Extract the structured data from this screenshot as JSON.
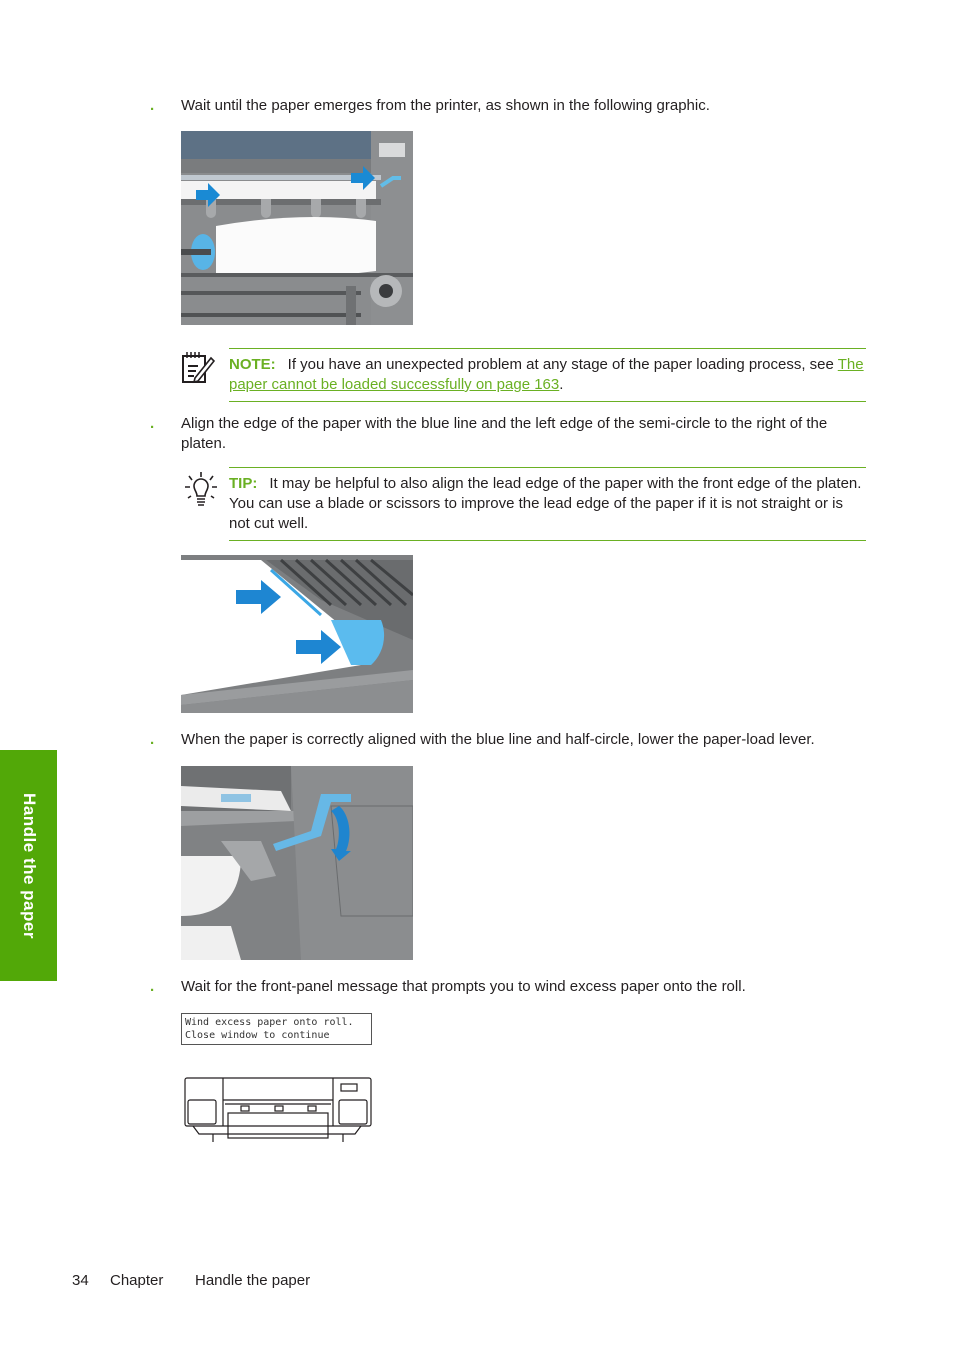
{
  "steps": [
    {
      "bullet": ".",
      "text": "Wait until the paper emerges from the printer, as shown in the following graphic."
    },
    {
      "bullet": ".",
      "text": "Align the edge of the paper with the blue line and the left edge of the semi-circle to the right of the platen."
    },
    {
      "bullet": ".",
      "text": "When the paper is correctly aligned with the blue line and half-circle, lower the paper-load lever."
    },
    {
      "bullet": ".",
      "text": "Wait for the front-panel message that prompts you to wind excess paper onto the roll."
    }
  ],
  "note": {
    "icon": "note-pencil-icon",
    "label": "NOTE:",
    "text_before": "If you have an unexpected problem at any stage of the paper loading process, see ",
    "link_text": "The paper cannot be loaded successfully on page 163",
    "text_after": "."
  },
  "tip": {
    "icon": "lightbulb-icon",
    "label": "TIP:",
    "text": "It may be helpful to also align the lead edge of the paper with the front edge of the platen. You can use a blade or scissors to improve the lead edge of the paper if it is not straight or is not cut well."
  },
  "figures": [
    {
      "name": "paper-emerging-figure",
      "description": "Printer with paper emerging from platen, blue arrows"
    },
    {
      "name": "paper-alignment-figure",
      "description": "Paper edge aligned with blue line and semi-circle"
    },
    {
      "name": "paper-load-lever-figure",
      "description": "Blue paper-load lever with downward arrow"
    },
    {
      "name": "printer-front-diagram",
      "description": "Line drawing of printer front"
    }
  ],
  "front_panel": {
    "line1": "Wind excess paper onto roll.",
    "line2": "Close window to continue"
  },
  "side_tab": {
    "label": "Handle the paper"
  },
  "footer": {
    "page_number": "34",
    "chapter_label": "Chapter",
    "chapter_title": "Handle the paper"
  },
  "colors": {
    "accent_green": "#6ab023",
    "tab_green": "#52a808",
    "highlight_blue": "#1a8ad4"
  }
}
